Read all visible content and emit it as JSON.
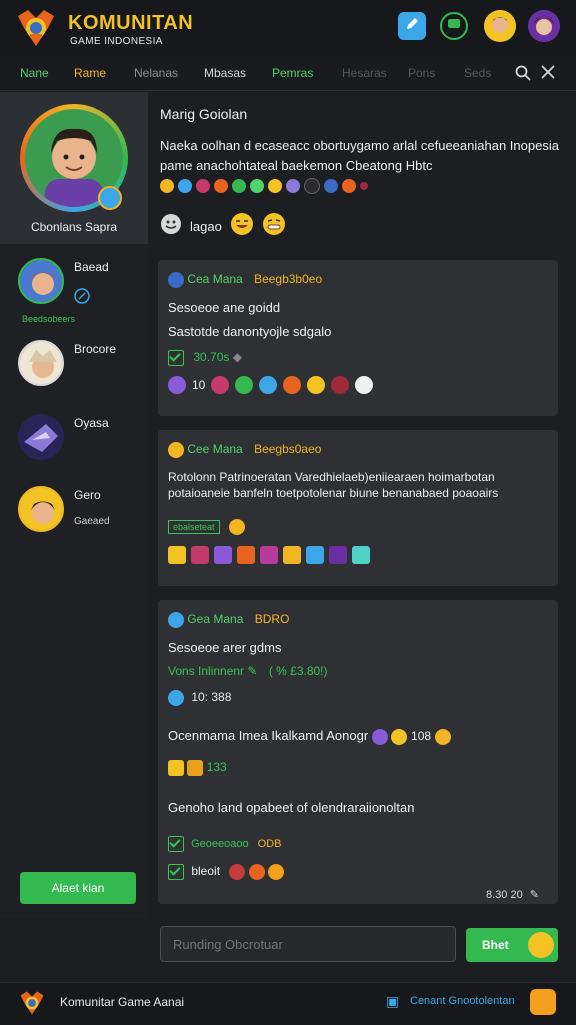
{
  "app": {
    "title": "KOMUNITAN",
    "subtitle": "GAME INDONESIA"
  },
  "nav": {
    "tabs": [
      "Nane",
      "Rame",
      "Nelanas",
      "Mbasas",
      "Pemras",
      "Hesaras",
      "Pons",
      "Seds"
    ],
    "active_index": 1
  },
  "sidebar": {
    "profile_name": "Cbonlans Sapra",
    "contacts": [
      {
        "name": "Baead",
        "sub": "Beedsobeers"
      },
      {
        "name": "Brocore",
        "sub": ""
      },
      {
        "name": "Oyasa",
        "sub": ""
      },
      {
        "name": "Gero",
        "sub": "Gaeaed"
      }
    ],
    "action_button": "Alaet kian"
  },
  "intro": {
    "title": "Marig Goiolan",
    "text": "Naeka oolhan d ecaseacc obortuygamo arlal cefueeaniahan Inopesia pame anachohtateal baekemon Cbeatong Hbtc",
    "reaction_label": "lagao"
  },
  "posts": [
    {
      "author": "Cea Mana",
      "time": "Beegb3b0eo",
      "lines": [
        "Sesoeoe ane goidd",
        "Sastotde danontyojle sdgalo"
      ],
      "meta": "30.70s",
      "count": "10"
    },
    {
      "author": "Cee Mana",
      "time": "Beegbs0aeo",
      "lines": [
        "Rotolonn Patrinoeratan Varedhielaeb)eniiearaen hoimarbotan",
        "potaioaneie banfeln toetpotolenar biune benanabaed poaoairs"
      ],
      "meta": "ebalseteat"
    },
    {
      "author": "Gea Mana",
      "time": "BDRO",
      "lines": [
        "Sesoeoe arer gdms"
      ],
      "quote": "Vons Inlinnenr",
      "quote_extra": "( % £3.80!)",
      "time2": "10: 388",
      "line2": "Ocenmama Imea Ikalkamd Aonogr",
      "line2_count": "108",
      "count2": "133",
      "line3": "Genoho land opabeet of olendraraiionoltan",
      "meta": "Geoeeoaoo",
      "meta_tag": "ODB",
      "meta2": "bleoit",
      "stamp": "8.30 20"
    }
  ],
  "composer": {
    "placeholder": "Runding Obcrotuar",
    "send_label": "Bhet"
  },
  "footer": {
    "left_label": "Komunitar Game Aanai",
    "right_label": "Cenant Gnootolentan"
  },
  "colors": {
    "accent_green": "#33b94f",
    "accent_gold": "#f2b523",
    "bg": "#1c1e21"
  }
}
